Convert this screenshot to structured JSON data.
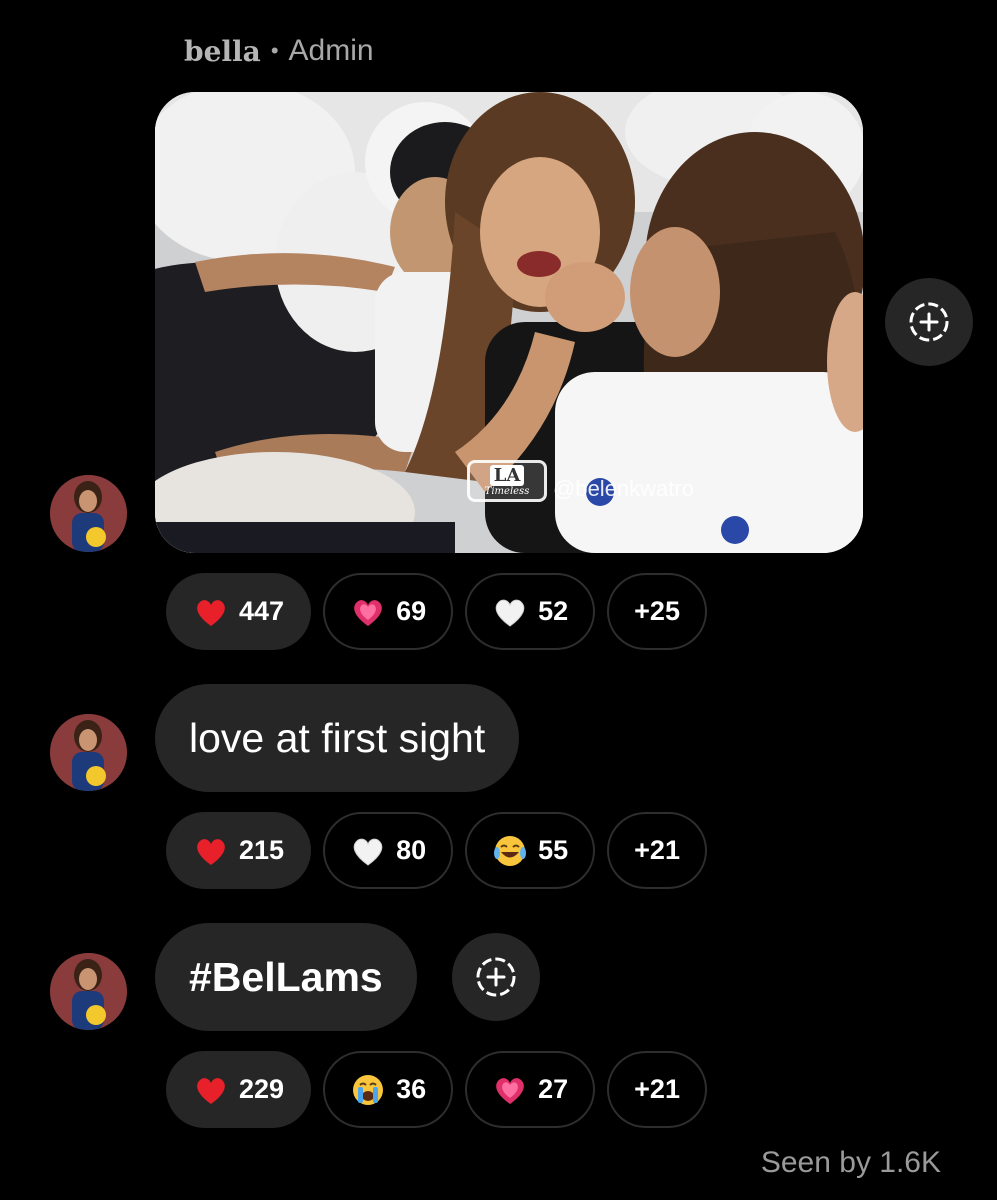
{
  "header": {
    "sender_name": "bella",
    "separator": "•",
    "role": "Admin"
  },
  "messages": [
    {
      "type": "image",
      "watermark": {
        "logo": "LA",
        "logo_sub": "Timeless",
        "handle": "@belenkwatro"
      },
      "reactions": [
        {
          "emoji": "red-heart",
          "count": "447",
          "active": true
        },
        {
          "emoji": "pink-heart",
          "count": "69",
          "active": false
        },
        {
          "emoji": "white-heart",
          "count": "52",
          "active": false
        },
        {
          "emoji": "",
          "count": "+25",
          "active": false
        }
      ]
    },
    {
      "type": "text",
      "text": "love at first sight",
      "reactions": [
        {
          "emoji": "red-heart",
          "count": "215",
          "active": true
        },
        {
          "emoji": "white-heart",
          "count": "80",
          "active": false
        },
        {
          "emoji": "laughing-face",
          "count": "55",
          "active": false
        },
        {
          "emoji": "",
          "count": "+21",
          "active": false
        }
      ]
    },
    {
      "type": "text",
      "text": "#BelLams",
      "reactions": [
        {
          "emoji": "red-heart",
          "count": "229",
          "active": true
        },
        {
          "emoji": "crying-face",
          "count": "36",
          "active": false
        },
        {
          "emoji": "pink-heart",
          "count": "27",
          "active": false
        },
        {
          "emoji": "",
          "count": "+21",
          "active": false
        }
      ]
    }
  ],
  "footer": {
    "seen_text": "Seen by 1.6K"
  },
  "colors": {
    "background": "#000000",
    "bubble": "#262626",
    "muted_text": "#9a9a9a",
    "heart_red": "#e8202a",
    "heart_pink": "#e0306a"
  }
}
